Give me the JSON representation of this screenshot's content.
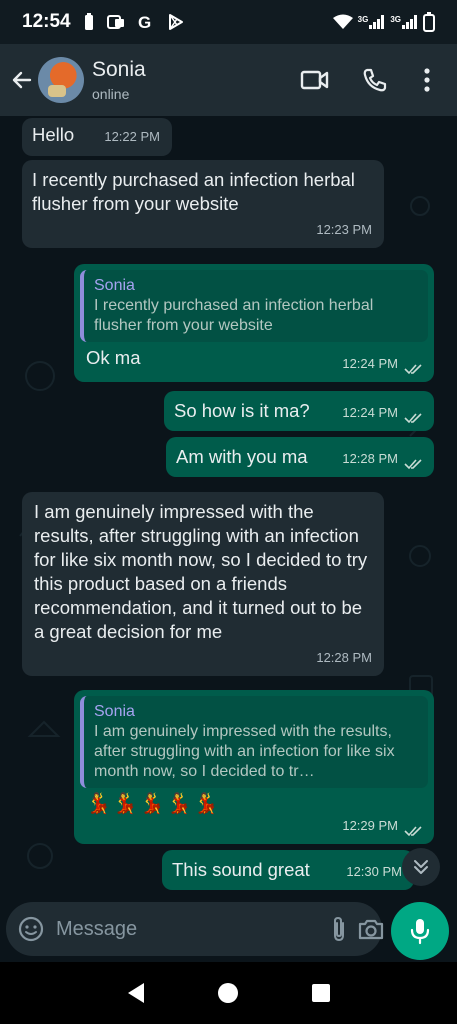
{
  "status_bar": {
    "time": "12:54",
    "carrier_tag_1": "3G",
    "carrier_tag_2": "3G"
  },
  "header": {
    "contact_name": "Sonia",
    "contact_status": "online"
  },
  "messages": [
    {
      "direction": "in",
      "text": "Hello",
      "time": "12:22 PM"
    },
    {
      "direction": "in",
      "text": "I recently purchased an infection herbal flusher from your website",
      "time": "12:23 PM"
    },
    {
      "direction": "out",
      "quote_name": "Sonia",
      "quote_text": "I recently purchased an infection herbal flusher from your website",
      "text": "Ok ma",
      "time": "12:24 PM"
    },
    {
      "direction": "out",
      "text": "So how is it ma?",
      "time": "12:24 PM"
    },
    {
      "direction": "out",
      "text": "Am with you ma",
      "time": "12:28 PM"
    },
    {
      "direction": "in",
      "text": "I am genuinely impressed with the results, after struggling with an infection for like six month now, so I decided to try this product based on a friends recommendation, and it turned out to be a great decision for me",
      "time": "12:28 PM"
    },
    {
      "direction": "out",
      "quote_name": "Sonia",
      "quote_text": "I am genuinely impressed with the results, after struggling with an infection for like six month now, so I decided to tr…",
      "text": "💃💃💃💃💃",
      "time": "12:29 PM"
    },
    {
      "direction": "out",
      "text": "This sound great",
      "time": "12:30 PM"
    }
  ],
  "composer": {
    "placeholder": "Message"
  },
  "colors": {
    "accent": "#00a884",
    "outgoing_bubble": "#005c4b",
    "incoming_bubble": "#202c33",
    "read_ticks": "#53bdeb"
  }
}
